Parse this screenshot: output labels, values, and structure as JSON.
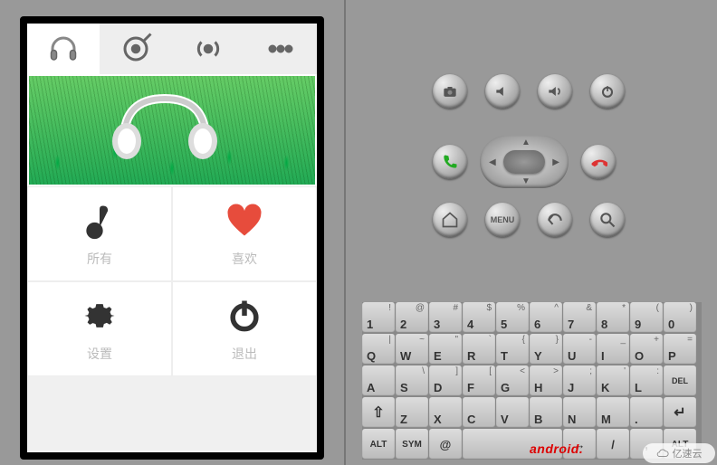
{
  "app": {
    "tabs": [
      {
        "name": "headphones",
        "active": true
      },
      {
        "name": "target",
        "active": false
      },
      {
        "name": "radio",
        "active": false
      },
      {
        "name": "more",
        "active": false
      }
    ],
    "grid": {
      "all": {
        "label": "所有",
        "icon": "music-note"
      },
      "favorite": {
        "label": "喜欢",
        "icon": "heart"
      },
      "settings": {
        "label": "设置",
        "icon": "gear"
      },
      "exit": {
        "label": "退出",
        "icon": "power"
      }
    }
  },
  "emulator": {
    "buttons": {
      "camera": "camera",
      "volDown": "volume-down",
      "volUp": "volume-up",
      "power": "power",
      "call": "call",
      "hangup": "hangup",
      "home": "home",
      "menu": "MENU",
      "back": "back",
      "search": "search"
    },
    "keyboard": {
      "row1": [
        {
          "main": "1",
          "shift": "!"
        },
        {
          "main": "2",
          "shift": "@"
        },
        {
          "main": "3",
          "shift": "#"
        },
        {
          "main": "4",
          "shift": "$"
        },
        {
          "main": "5",
          "shift": "%"
        },
        {
          "main": "6",
          "shift": "^"
        },
        {
          "main": "7",
          "shift": "&"
        },
        {
          "main": "8",
          "shift": "*"
        },
        {
          "main": "9",
          "shift": "("
        },
        {
          "main": "0",
          "shift": ")"
        }
      ],
      "row2": [
        {
          "main": "Q",
          "shift": "|"
        },
        {
          "main": "W",
          "shift": "~"
        },
        {
          "main": "E",
          "shift": "\""
        },
        {
          "main": "R",
          "shift": "`"
        },
        {
          "main": "T",
          "shift": "{"
        },
        {
          "main": "Y",
          "shift": "}"
        },
        {
          "main": "U",
          "shift": "-"
        },
        {
          "main": "I",
          "shift": "_"
        },
        {
          "main": "O",
          "shift": "+"
        },
        {
          "main": "P",
          "shift": "="
        }
      ],
      "row3": [
        {
          "main": "A",
          "shift": ""
        },
        {
          "main": "S",
          "shift": "\\"
        },
        {
          "main": "D",
          "shift": "]"
        },
        {
          "main": "F",
          "shift": "["
        },
        {
          "main": "G",
          "shift": "<"
        },
        {
          "main": "H",
          "shift": ">"
        },
        {
          "main": "J",
          "shift": ";"
        },
        {
          "main": "K",
          "shift": "'"
        },
        {
          "main": "L",
          "shift": ":"
        },
        {
          "main": "DEL",
          "shift": ""
        }
      ],
      "row4": [
        {
          "main": "⇧",
          "shift": ""
        },
        {
          "main": "Z",
          "shift": ""
        },
        {
          "main": "X",
          "shift": ""
        },
        {
          "main": "C",
          "shift": ""
        },
        {
          "main": "V",
          "shift": ""
        },
        {
          "main": "B",
          "shift": ""
        },
        {
          "main": "N",
          "shift": ""
        },
        {
          "main": "M",
          "shift": ""
        },
        {
          "main": ".",
          "shift": ""
        },
        {
          "main": "↵",
          "shift": ""
        }
      ],
      "row5": {
        "alt": "ALT",
        "sym": "SYM",
        "at": "@",
        "search": "",
        "slash": "/",
        "comma": ",",
        "altR": "ALT"
      }
    },
    "brand": "android."
  },
  "watermark": {
    "label": "亿速云"
  }
}
